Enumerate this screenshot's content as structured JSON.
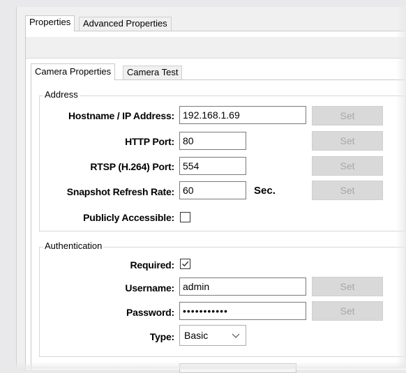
{
  "tabs": [
    {
      "label": "Properties",
      "active": true
    },
    {
      "label": "Advanced Properties",
      "active": false
    }
  ],
  "subtabs": [
    {
      "label": "Camera Properties",
      "active": true
    },
    {
      "label": "Camera Test",
      "active": false
    }
  ],
  "address": {
    "title": "Address",
    "hostname_label": "Hostname / IP Address:",
    "hostname_value": "192.168.1.69",
    "http_label": "HTTP Port:",
    "http_value": "80",
    "rtsp_label": "RTSP (H.264) Port:",
    "rtsp_value": "554",
    "snapshot_label": "Snapshot Refresh Rate:",
    "snapshot_value": "60",
    "snapshot_unit": "Sec.",
    "public_label": "Publicly Accessible:",
    "public_checked": false
  },
  "auth": {
    "title": "Authentication",
    "required_label": "Required:",
    "required_checked": true,
    "username_label": "Username:",
    "username_value": "admin",
    "password_label": "Password:",
    "password_value": "•••••••••••",
    "type_label": "Type:",
    "type_value": "Basic"
  },
  "set_label": "Set",
  "colors": {
    "disabled_button_bg": "#d9d9d9",
    "disabled_button_text": "#a7a7a7"
  }
}
